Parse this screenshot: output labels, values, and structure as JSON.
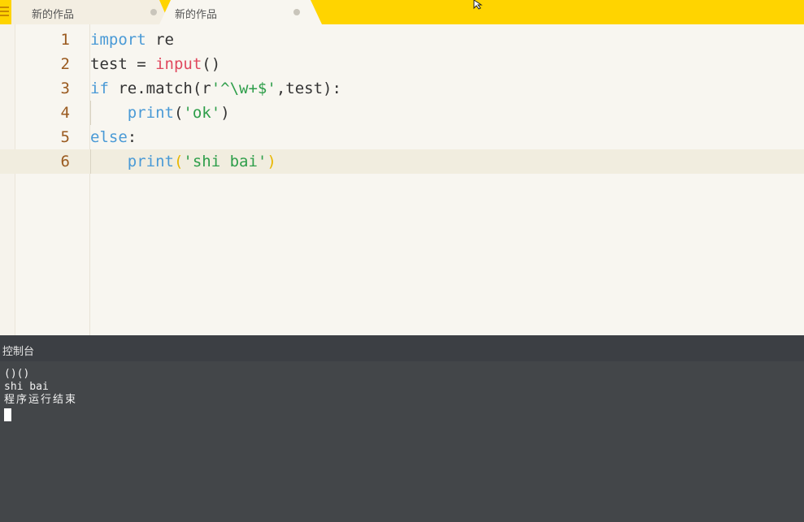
{
  "tabs": [
    {
      "label": "新的作品"
    },
    {
      "label": "新的作品"
    }
  ],
  "editor": {
    "line_numbers": [
      "1",
      "2",
      "3",
      "4",
      "5",
      "6"
    ],
    "lines": [
      [
        {
          "t": "kw",
          "v": "import"
        },
        {
          "t": "pl",
          "v": " re"
        }
      ],
      [
        {
          "t": "pl",
          "v": "test = "
        },
        {
          "t": "bi",
          "v": "input"
        },
        {
          "t": "pl",
          "v": "()"
        }
      ],
      [
        {
          "t": "kw",
          "v": "if"
        },
        {
          "t": "pl",
          "v": " re.match(r"
        },
        {
          "t": "str",
          "v": "'^\\w+$'"
        },
        {
          "t": "pl",
          "v": ",test):"
        }
      ],
      [
        {
          "t": "pl",
          "v": "    "
        },
        {
          "t": "fn",
          "v": "print"
        },
        {
          "t": "pl",
          "v": "("
        },
        {
          "t": "str",
          "v": "'ok'"
        },
        {
          "t": "pl",
          "v": ")"
        }
      ],
      [
        {
          "t": "kw",
          "v": "else"
        },
        {
          "t": "pl",
          "v": ":"
        }
      ],
      [
        {
          "t": "pl",
          "v": "    "
        },
        {
          "t": "fn",
          "v": "print"
        },
        {
          "t": "br-hi",
          "v": "("
        },
        {
          "t": "str",
          "v": "'shi bai'"
        },
        {
          "t": "br-hi",
          "v": ")"
        }
      ]
    ],
    "current_line": 6
  },
  "console": {
    "title": "控制台",
    "output": [
      "()()",
      "shi bai",
      "程序运行结束"
    ]
  },
  "colors": {
    "accent": "#ffd400",
    "keyword": "#4a9ad6",
    "builtin": "#e0485e",
    "string": "#2e9e4a",
    "line_number": "#9a5a1f",
    "console_bg": "#434649"
  }
}
